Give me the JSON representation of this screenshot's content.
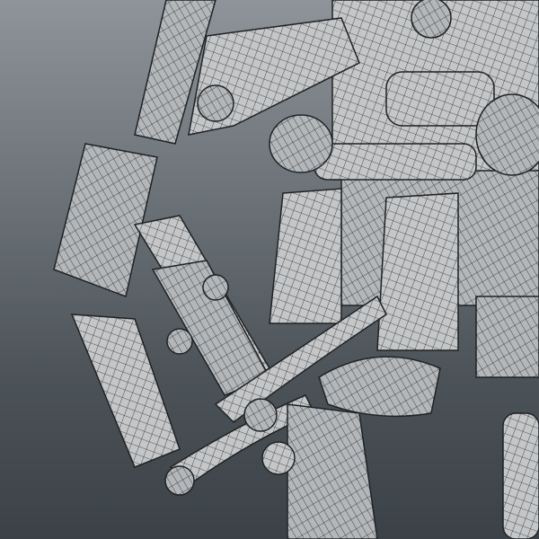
{
  "scene": {
    "subject": "",
    "colors": {
      "background_top": "#8e9499",
      "background_bottom": "#3b4247",
      "surface": "#c9cbcc",
      "wire": "#2a2d30"
    }
  }
}
